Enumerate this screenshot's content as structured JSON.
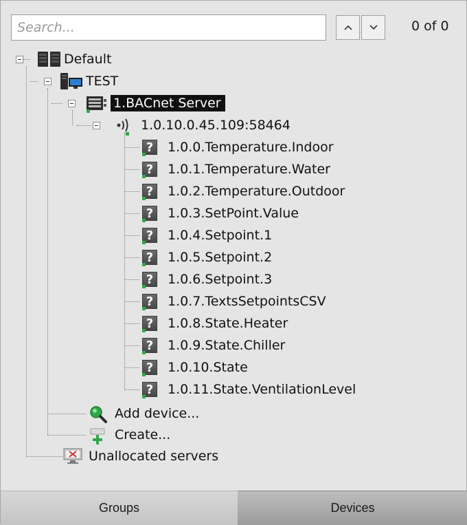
{
  "search": {
    "placeholder": "Search...",
    "value": ""
  },
  "navigation": {
    "up_icon": "chevron-up-icon",
    "down_icon": "chevron-down-icon"
  },
  "counter": "0 of 0",
  "tree": {
    "root": {
      "label": "Default",
      "icon": "server-group-icon"
    },
    "computer": {
      "label": "TEST",
      "icon": "computer-icon"
    },
    "server": {
      "label": "1.BACnet Server",
      "icon": "controller-icon",
      "selected": true
    },
    "device": {
      "label": "1.0.10.0.45.109:58464",
      "icon": "network-signal-icon"
    },
    "objects": [
      "1.0.0.Temperature.Indoor",
      "1.0.1.Temperature.Water",
      "1.0.2.Temperature.Outdoor",
      "1.0.3.SetPoint.Value",
      "1.0.4.Setpoint.1",
      "1.0.5.Setpoint.2",
      "1.0.6.Setpoint.3",
      "1.0.7.TextsSetpointsCSV",
      "1.0.8.State.Heater",
      "1.0.9.State.Chiller",
      "1.0.10.State",
      "1.0.11.State.VentilationLevel"
    ],
    "object_icon": "question-mark-icon",
    "add_device": {
      "label": "Add device...",
      "icon": "magnifier-icon"
    },
    "create": {
      "label": "Create...",
      "icon": "create-plus-icon"
    },
    "unallocated": {
      "label": "Unallocated servers",
      "icon": "unallocated-server-icon"
    }
  },
  "tabs": [
    {
      "label": "Groups",
      "active": false
    },
    {
      "label": "Devices",
      "active": true
    }
  ],
  "colors": {
    "background": "#e4e4e4",
    "selection": "#101010",
    "accent_green": "#2fa74a",
    "monitor_blue": "#2a7fd0"
  }
}
